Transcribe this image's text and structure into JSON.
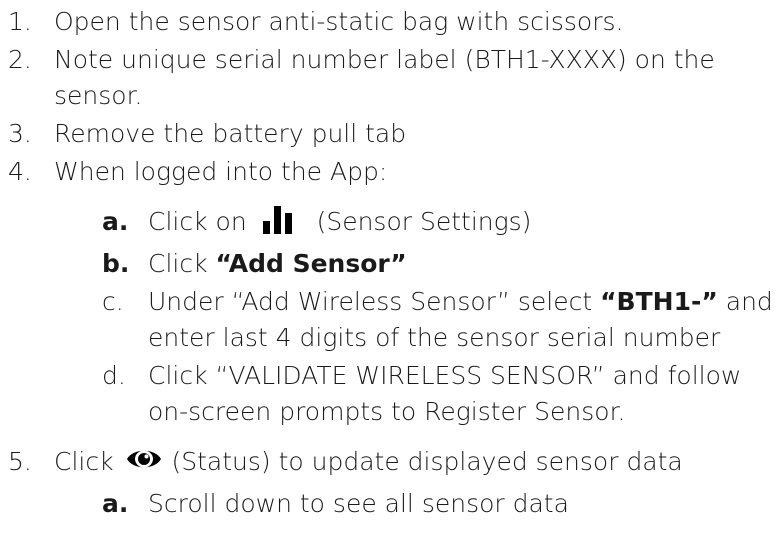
{
  "steps": [
    {
      "num": "1.",
      "text": "Open the sensor anti-static bag with scissors."
    },
    {
      "num": "2.",
      "line1": "Note unique serial number label (BTH1-XXXX) on the",
      "line2": "sensor."
    },
    {
      "num": "3.",
      "text": "Remove the battery pull tab"
    },
    {
      "num": "4.",
      "text": "When logged into the App:"
    }
  ],
  "substeps4": {
    "a": {
      "letter": "a.",
      "pre": "Click on",
      "icon": "bar-chart-icon",
      "post": "(Sensor Settings)"
    },
    "b": {
      "letter": "b.",
      "pre": "Click ",
      "bold": "“Add Sensor”"
    },
    "c": {
      "letter": "c.",
      "pre": "Under “Add Wireless Sensor” select ",
      "bold": "“BTH1-”",
      "post": " and",
      "line2": "enter last 4 digits of the sensor serial number"
    },
    "d": {
      "letter": "d.",
      "line1": "Click “VALIDATE WIRELESS SENSOR” and follow",
      "line2": "on-screen prompts to Register Sensor."
    }
  },
  "step5": {
    "num": "5.",
    "pre": "Click",
    "icon": "eye-icon",
    "post": "(Status) to update displayed sensor data"
  },
  "substeps5": {
    "a": {
      "letter": "a.",
      "text": "Scroll down to see all sensor data"
    }
  }
}
